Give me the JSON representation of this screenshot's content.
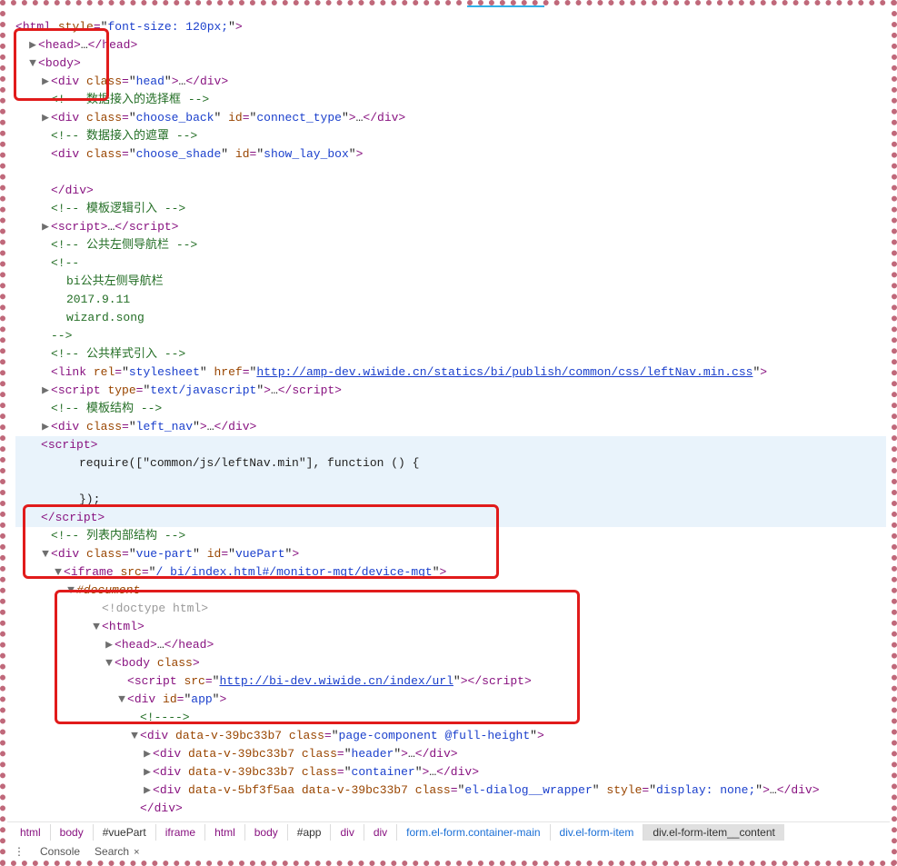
{
  "doc": {
    "html_open": {
      "style": "font-size: 120px;"
    },
    "head": {
      "ellipsis": "…"
    },
    "body": {},
    "div_head": {
      "class": "head",
      "ellipsis": "…"
    },
    "cmt_choose": "数据接入的选择框",
    "div_choose_back": {
      "class": "choose_back",
      "id": "connect_type",
      "ellipsis": "…"
    },
    "cmt_shade": "数据接入的遮罩",
    "div_choose_shade": {
      "class": "choose_shade",
      "id": "show_lay_box"
    },
    "cmt_template": "模板逻辑引入",
    "script1": {
      "ellipsis": "…"
    },
    "cmt_leftnav": "公共左侧导航栏",
    "cmt_block": [
      "bi公共左侧导航栏",
      "2017.9.11",
      "wizard.song"
    ],
    "cmt_style": "公共样式引入",
    "link_css": {
      "rel": "stylesheet",
      "href": "http://amp-dev.wiwide.cn/statics/bi/publish/common/css/leftNav.min.css"
    },
    "script_text": {
      "type": "text/javascript",
      "ellipsis": "…"
    },
    "cmt_struct": "模板结构",
    "div_left_nav": {
      "class": "left_nav",
      "ellipsis": "…"
    },
    "script_require": {
      "l1": "require([\"common/js/leftNav.min\"], function () {",
      "l2": "});"
    },
    "cmt_list": "列表内部结构",
    "vue_part": {
      "class": "vue-part",
      "id": "vuePart"
    },
    "iframe": {
      "src": "/_bi/index.html#/monitor-mgt/device-mgt"
    },
    "hashdoc": "#document",
    "doctype": "<!doctype html>",
    "inner_head": {
      "ellipsis": "…"
    },
    "inner_body_class": "class",
    "inner_script": {
      "src": "http://bi-dev.wiwide.cn/index/url"
    },
    "div_app": {
      "id": "app"
    },
    "cmt_blank": "",
    "div_page_comp": {
      "data_v": "data-v-39bc33b7",
      "class": "page-component @full-height"
    },
    "div_header": {
      "data_v": "data-v-39bc33b7",
      "class": "header",
      "ellipsis": "…"
    },
    "div_container": {
      "data_v": "data-v-39bc33b7",
      "class": "container",
      "ellipsis": "…"
    },
    "div_dialog": {
      "data_v1": "data-v-5bf3f5aa",
      "data_v2": "data-v-39bc33b7",
      "class": "el-dialog__wrapper",
      "style": "display: none;",
      "ellipsis": "…"
    }
  },
  "breadcrumb": [
    {
      "label": "html",
      "kind": "tag"
    },
    {
      "label": "body",
      "kind": "tag"
    },
    {
      "label": "#vuePart",
      "kind": "black"
    },
    {
      "label": "iframe",
      "kind": "tag"
    },
    {
      "label": "html",
      "kind": "tag"
    },
    {
      "label": "body",
      "kind": "tag"
    },
    {
      "label": "#app",
      "kind": "black"
    },
    {
      "label": "div",
      "kind": "tag"
    },
    {
      "label": "div",
      "kind": "tag"
    },
    {
      "label": "form.el-form.container-main",
      "kind": "link"
    },
    {
      "label": "div.el-form-item",
      "kind": "link"
    },
    {
      "label": "div.el-form-item__content",
      "kind": "selected"
    }
  ],
  "tabs": {
    "console": "Console",
    "search": "Search"
  }
}
